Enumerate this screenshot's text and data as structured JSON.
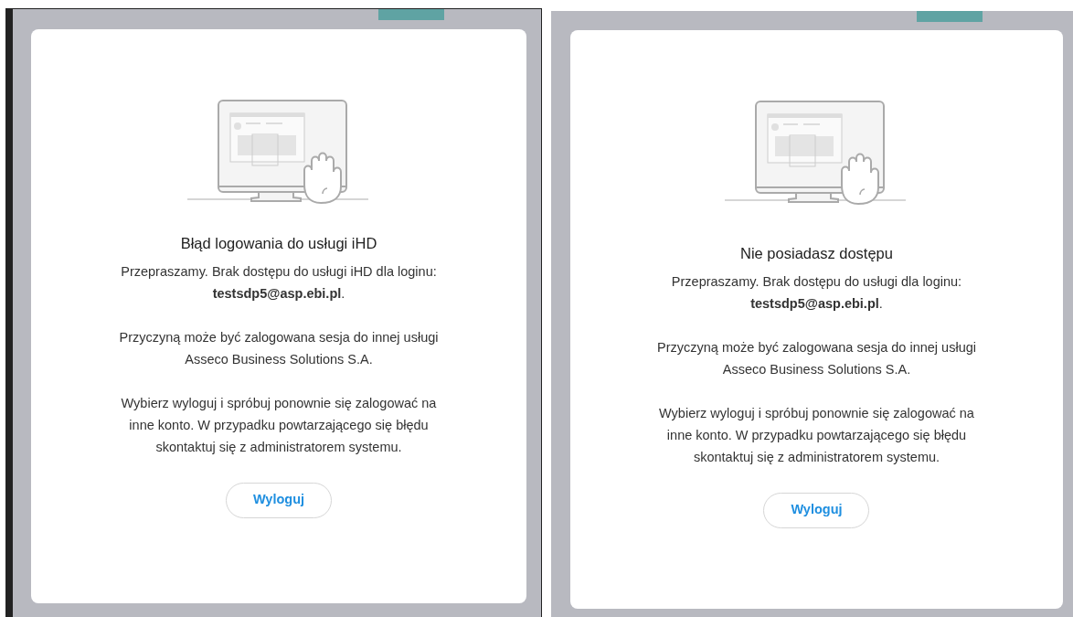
{
  "panels": [
    {
      "title": "Błąd logowania do usługi iHD",
      "paragraphs": [
        "Przepraszamy. Brak dostępu do usługi iHD dla loginu: **testsdp5@asp.ebi.pl**.",
        "Przyczyną może być zalogowana sesja do innej usługi Asseco Business Solutions S.A.",
        "Wybierz wyloguj i spróbuj ponownie się zalogować na inne konto. W przypadku powtarzającego się błędu skontaktuj się z administratorem systemu."
      ],
      "button": "Wyloguj"
    },
    {
      "title": "Nie posiadasz dostępu",
      "paragraphs": [
        "Przepraszamy. Brak dostępu do usługi dla loginu: **testsdp5@asp.ebi.pl**.",
        "Przyczyną może być zalogowana sesja do innej usługi Asseco Business Solutions S.A.",
        "Wybierz wyloguj i spróbuj ponownie się zalogować na inne konto. W przypadku powtarzającego się błędu skontaktuj się z administratorem systemu."
      ],
      "button": "Wyloguj"
    }
  ]
}
